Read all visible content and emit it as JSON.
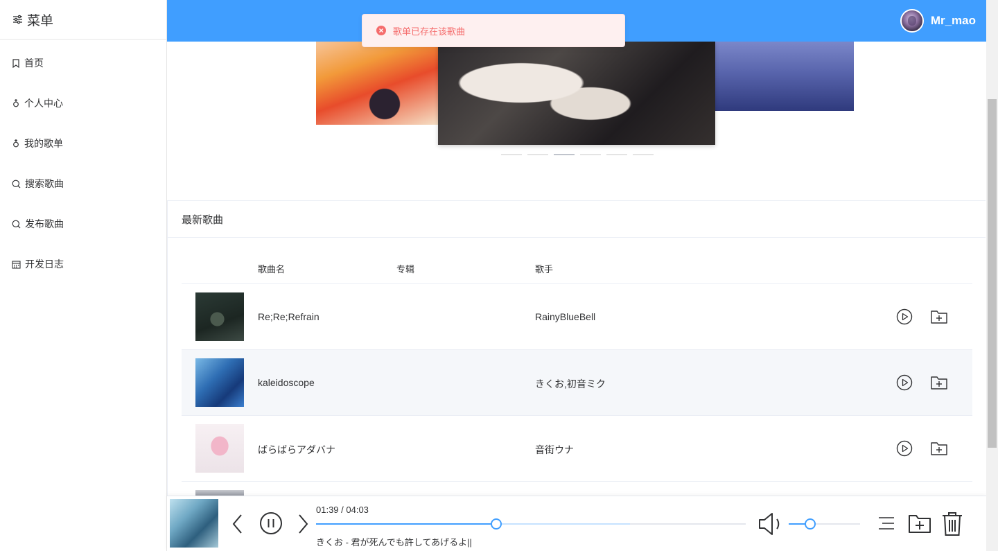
{
  "sidebar": {
    "title": "菜单",
    "items": [
      {
        "label": "首页",
        "icon": "bookmark-icon"
      },
      {
        "label": "个人中心",
        "icon": "female-icon"
      },
      {
        "label": "我的歌单",
        "icon": "female-icon"
      },
      {
        "label": "搜索歌曲",
        "icon": "search-icon"
      },
      {
        "label": "发布歌曲",
        "icon": "search-icon"
      },
      {
        "label": "开发日志",
        "icon": "calendar-icon"
      }
    ]
  },
  "header": {
    "username": "Mr_mao",
    "accent": "#409eff"
  },
  "toast": {
    "message": "歌单已存在该歌曲",
    "type": "error",
    "color": "#f56c6c"
  },
  "carousel": {
    "slide_count": 6,
    "active_index": 2
  },
  "latest": {
    "title": "最新歌曲",
    "columns": {
      "name": "歌曲名",
      "album": "专辑",
      "artist": "歌手"
    },
    "rows": [
      {
        "name": "Re;Re;Refrain",
        "album": "",
        "artist": "RainyBlueBell"
      },
      {
        "name": "kaleidoscope",
        "album": "",
        "artist": "きくお,初音ミク"
      },
      {
        "name": "ばらばらアダバナ",
        "album": "",
        "artist": "音街ウナ"
      }
    ]
  },
  "player": {
    "time": "01:39 / 04:03",
    "progress": 0.42,
    "buffered": 0.73,
    "volume": 0.3,
    "now_playing": "きくお - 君が死んでも許してあげるよ||"
  }
}
